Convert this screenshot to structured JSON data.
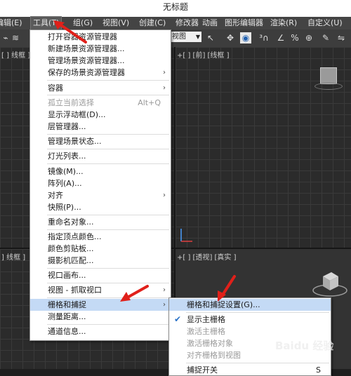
{
  "window": {
    "title": "无标题"
  },
  "menubar": {
    "items": [
      {
        "label": "编辑(E)"
      },
      {
        "label": "工具(T)"
      },
      {
        "label": "组(G)"
      },
      {
        "label": "视图(V)"
      },
      {
        "label": "创建(C)"
      },
      {
        "label": "修改器"
      },
      {
        "label": "动画"
      },
      {
        "label": "图形编辑器"
      },
      {
        "label": "渲染(R)"
      },
      {
        "label": "自定义(U)"
      }
    ]
  },
  "toolbar": {
    "view_dropdown": "视图"
  },
  "viewports": {
    "top_left_label": "[ ] 线框 ]",
    "front_label": "+[ ] [前] [线框 ]",
    "bottom_left_label": "] 线框 ]",
    "perspective_label": "+[ ] [透视] [真实 ]"
  },
  "tools_menu": {
    "items": [
      {
        "label": "打开容器资源管理器",
        "submenu": false
      },
      {
        "label": "新建场景资源管理器...",
        "submenu": false
      },
      {
        "label": "管理场景资源管理器...",
        "submenu": false
      },
      {
        "label": "保存的场景资源管理器",
        "submenu": true
      },
      {
        "label": "容器",
        "submenu": true
      },
      {
        "label": "孤立当前选择",
        "shortcut": "Alt+Q",
        "disabled": true
      },
      {
        "label": "显示浮动框(D)..."
      },
      {
        "label": "层管理器..."
      },
      {
        "label": "管理场景状态..."
      },
      {
        "label": "灯光列表..."
      },
      {
        "label": "镜像(M)..."
      },
      {
        "label": "阵列(A)..."
      },
      {
        "label": "对齐",
        "submenu": true
      },
      {
        "label": "快照(P)..."
      },
      {
        "label": "重命名对象..."
      },
      {
        "label": "指定顶点颜色..."
      },
      {
        "label": "颜色剪贴板..."
      },
      {
        "label": "摄影机匹配..."
      },
      {
        "label": "视口画布..."
      },
      {
        "label": "视图 - 抓取视口",
        "submenu": true
      },
      {
        "label": "栅格和捕捉",
        "submenu": true,
        "highlighted": true
      },
      {
        "label": "测量距离..."
      },
      {
        "label": "通道信息..."
      }
    ]
  },
  "grid_snap_submenu": {
    "items": [
      {
        "label": "栅格和捕捉设置(G)...",
        "highlighted": true
      },
      {
        "label": "显示主栅格",
        "checked": true
      },
      {
        "label": "激活主栅格",
        "disabled": true
      },
      {
        "label": "激活栅格对象",
        "disabled": true
      },
      {
        "label": "对齐栅格到视图",
        "disabled": true
      },
      {
        "label": "捕捉开关",
        "shortcut": "S"
      }
    ]
  },
  "watermark": "Baidu 经验",
  "colors": {
    "menu_highlight": "#c4daf5",
    "annotation_red": "#e0201a",
    "check_blue": "#2a72c8"
  }
}
